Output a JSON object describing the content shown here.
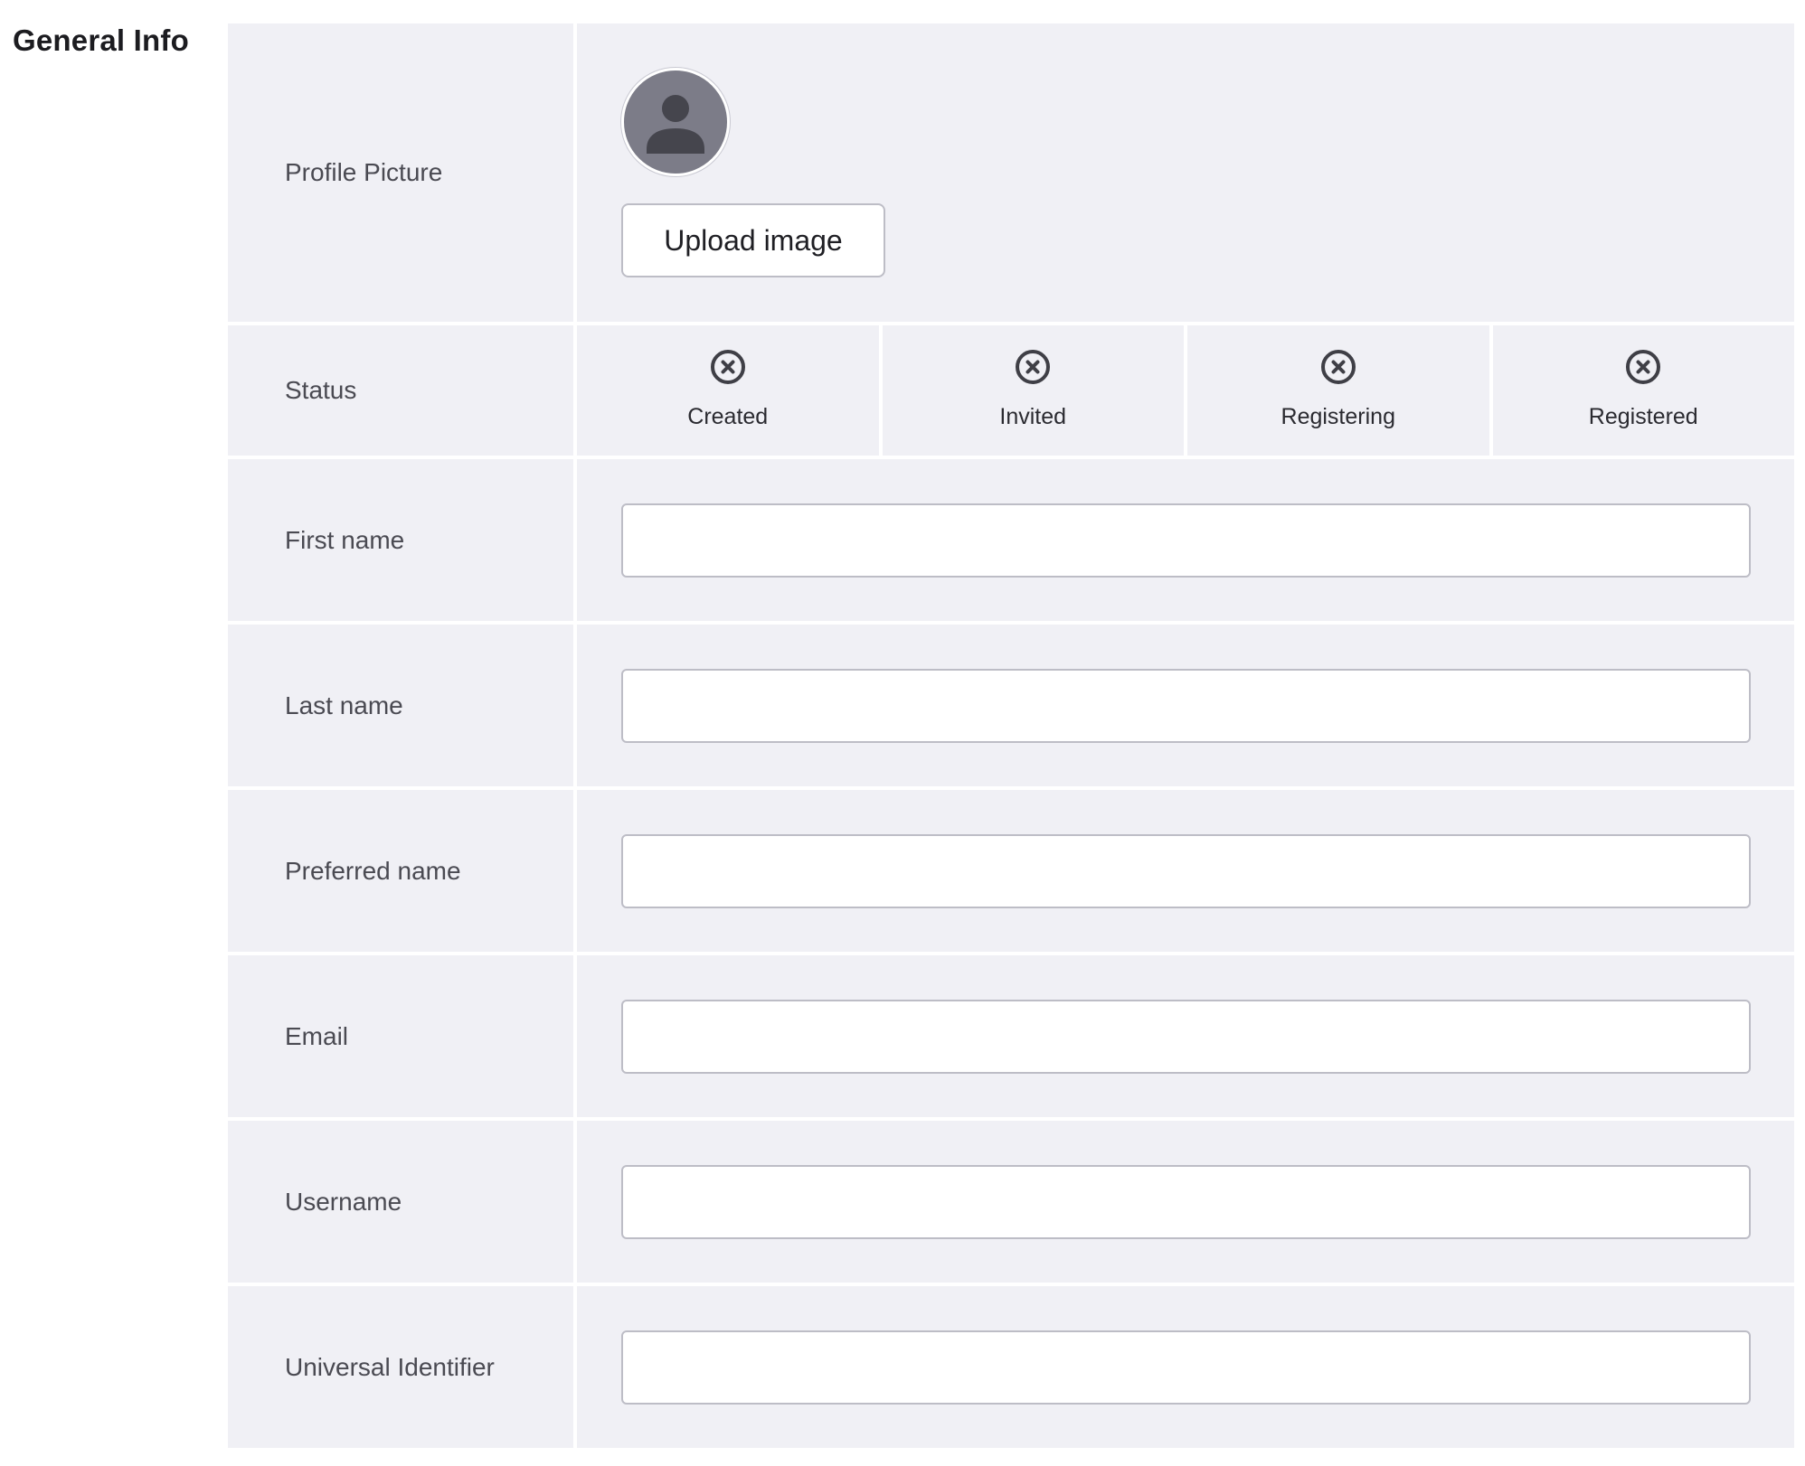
{
  "section": {
    "title": "General Info"
  },
  "profile": {
    "label": "Profile Picture",
    "avatar_icon": "user-avatar-icon",
    "upload_label": "Upload image"
  },
  "status": {
    "label": "Status",
    "items": [
      {
        "label": "Created",
        "icon": "circle-x-icon",
        "state": "incomplete"
      },
      {
        "label": "Invited",
        "icon": "circle-x-icon",
        "state": "incomplete"
      },
      {
        "label": "Registering",
        "icon": "circle-x-icon",
        "state": "incomplete"
      },
      {
        "label": "Registered",
        "icon": "circle-x-icon",
        "state": "incomplete"
      }
    ]
  },
  "fields": {
    "first_name": {
      "label": "First name",
      "value": ""
    },
    "last_name": {
      "label": "Last name",
      "value": ""
    },
    "preferred_name": {
      "label": "Preferred name",
      "value": ""
    },
    "email": {
      "label": "Email",
      "value": ""
    },
    "username": {
      "label": "Username",
      "value": ""
    },
    "universal_identifier": {
      "label": "Universal Identifier",
      "value": ""
    }
  },
  "colors": {
    "row_background": "#f0f0f5",
    "avatar_background": "#7c7c88",
    "avatar_figure": "#45454d",
    "status_icon": "#3f3f46",
    "input_border": "#bdbdc6"
  }
}
